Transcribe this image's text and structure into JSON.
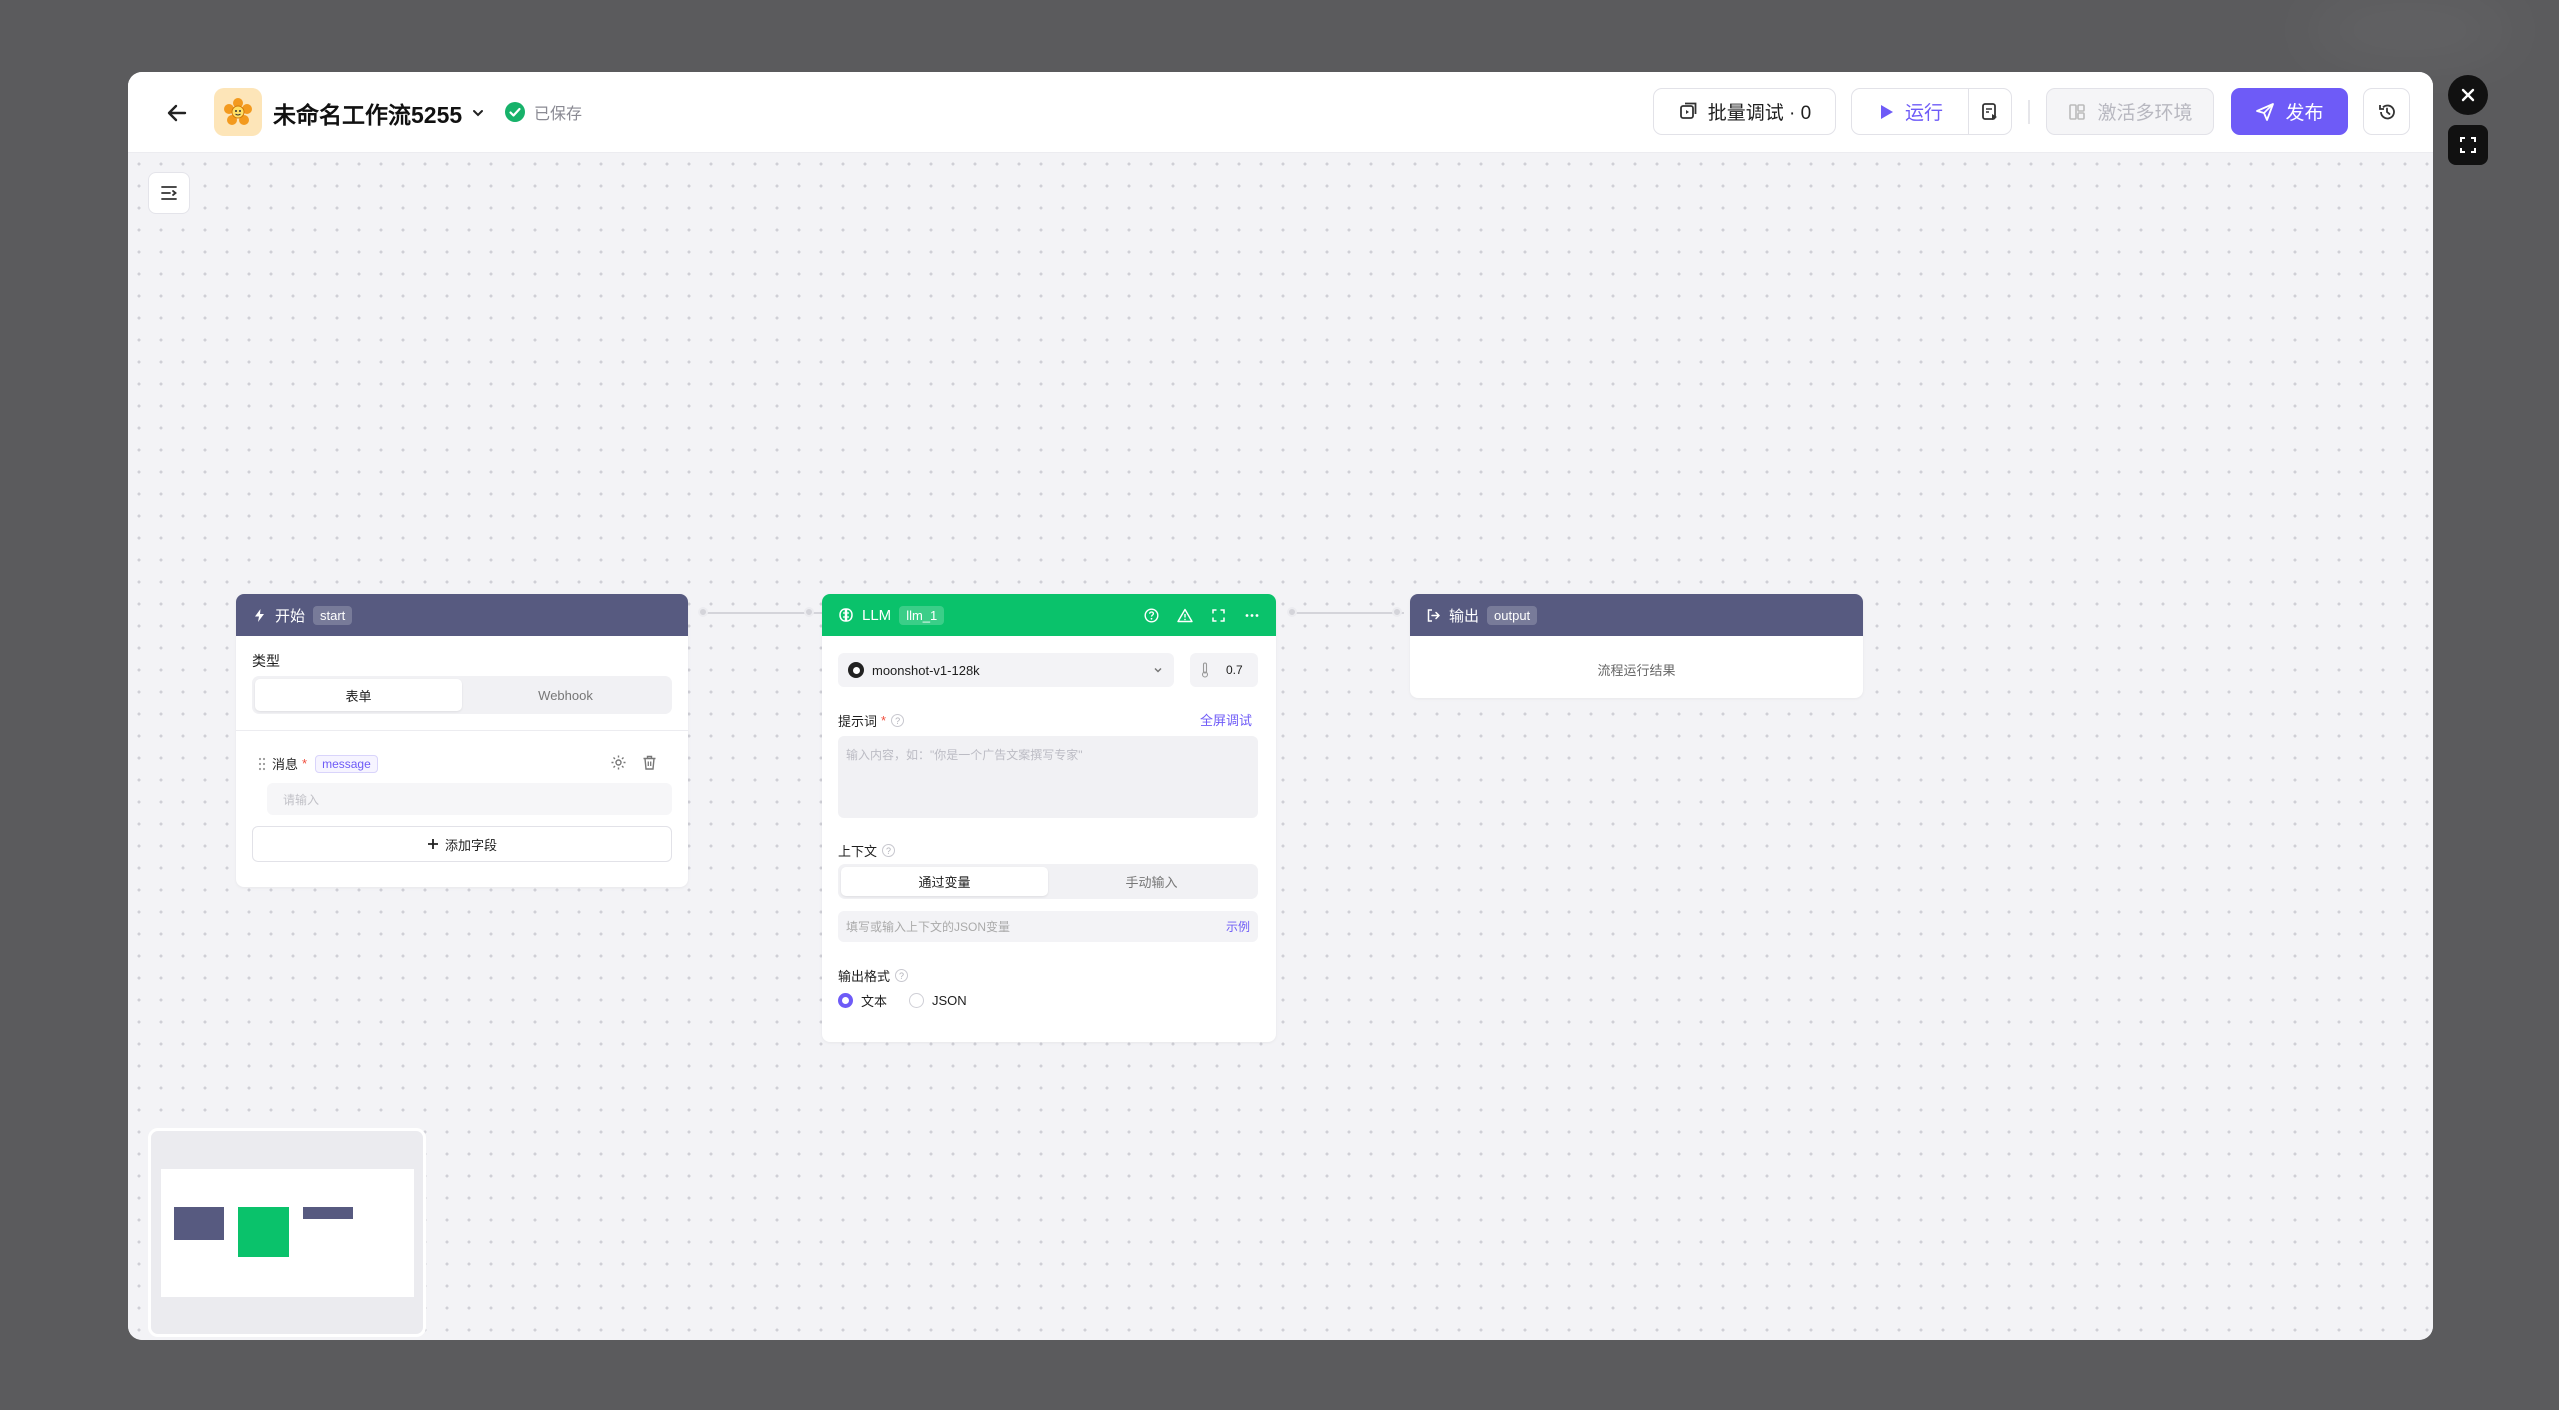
{
  "header": {
    "workflow_title": "未命名工作流5255",
    "saved_status": "已保存",
    "batch_debug_label": "批量调试 · 0",
    "run_label": "运行",
    "activate_env_label": "激活多环境",
    "publish_label": "发布"
  },
  "nodes": {
    "start": {
      "title": "开始",
      "tag": "start",
      "type_label": "类型",
      "type_options": [
        "表单",
        "Webhook"
      ],
      "field_label": "消息",
      "field_tag": "message",
      "field_placeholder": "请输入",
      "add_field_label": "添加字段"
    },
    "llm": {
      "title": "LLM",
      "tag": "llm_1",
      "model": "moonshot-v1-128k",
      "temperature": "0.7",
      "prompt_label": "提示词",
      "fullscreen_debug": "全屏调试",
      "prompt_placeholder": "输入内容，如：\"你是一个广告文案撰写专家\"",
      "context_label": "上下文",
      "context_options": [
        "通过变量",
        "手动输入"
      ],
      "context_placeholder": "填写或输入上下文的JSON变量",
      "example_link": "示例",
      "output_format_label": "输出格式",
      "format_options": [
        "文本",
        "JSON"
      ]
    },
    "output": {
      "title": "输出",
      "tag": "output",
      "result_text": "流程运行结果"
    }
  },
  "colors": {
    "accent": "#6e5bf7",
    "node_slate": "#575a80",
    "node_green": "#0ac26b"
  }
}
